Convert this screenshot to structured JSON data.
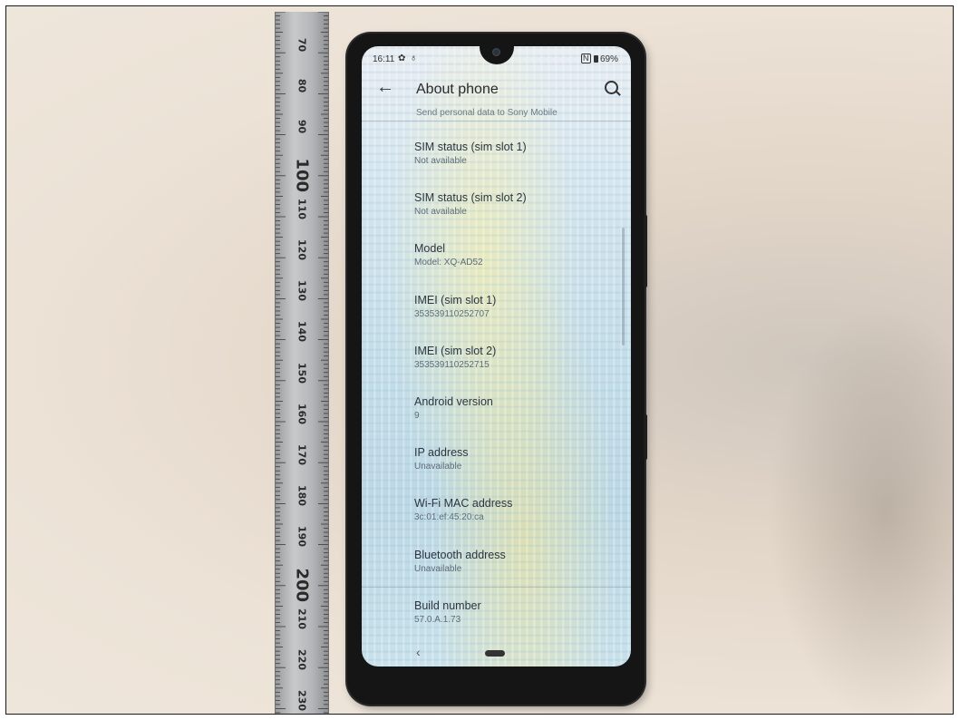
{
  "ruler": {
    "numbers": [
      "70",
      "80",
      "90",
      "100",
      "110",
      "120",
      "130",
      "140",
      "150",
      "160",
      "170",
      "180",
      "190",
      "200",
      "210",
      "220",
      "230"
    ]
  },
  "phone": {
    "status": {
      "time": "16:11",
      "nfc": "N",
      "battery": "69%"
    },
    "header": {
      "title": "About phone"
    },
    "partial_item": "Send personal data to Sony Mobile",
    "items": [
      {
        "title": "SIM status (sim slot 1)",
        "value": "Not available"
      },
      {
        "title": "SIM status (sim slot 2)",
        "value": "Not available"
      },
      {
        "title": "Model",
        "value": "Model: XQ-AD52"
      },
      {
        "title": "IMEI (sim slot 1)",
        "value": "353539110252707"
      },
      {
        "title": "IMEI (sim slot 2)",
        "value": "353539110252715"
      },
      {
        "title": "Android version",
        "value": "9"
      },
      {
        "title": "IP address",
        "value": "Unavailable"
      },
      {
        "title": "Wi-Fi MAC address",
        "value": "3c:01:ef:45:20:ca"
      },
      {
        "title": "Bluetooth address",
        "value": "Unavailable"
      },
      {
        "title": "Build number",
        "value": "57.0.A.1.73"
      }
    ],
    "nav": {
      "back": "‹"
    }
  },
  "colors": {
    "phone_body": "#151515",
    "surface": "#efe6db",
    "ruler": "#b3b5b8"
  }
}
